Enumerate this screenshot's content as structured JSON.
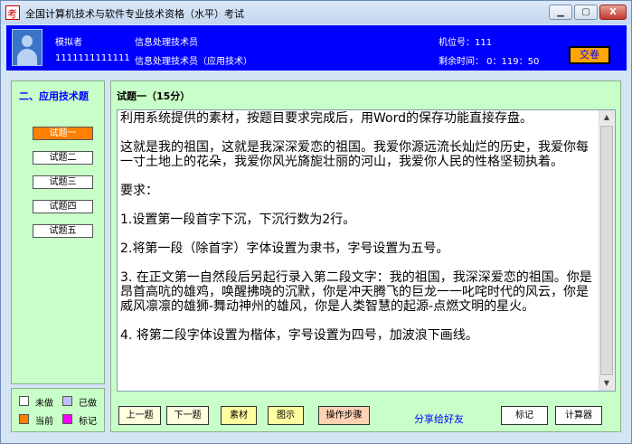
{
  "window": {
    "title": "全国计算机技术与软件专业技术资格（水平）考试",
    "minimize_symbol": "▁",
    "maximize_symbol": "▢",
    "close_symbol": "X"
  },
  "header": {
    "name": "模拟者",
    "candidate_no": "1111111111111",
    "exam_name": "信息处理技术员",
    "exam_subject": "信息处理技术员（应用技术）",
    "seat_label": "机位号：111",
    "time_label": "剩余时间：  0：119：50",
    "submit_label": "交卷"
  },
  "left": {
    "section_title": "二、应用技术题",
    "questions": [
      "试题一",
      "试题二",
      "试题三",
      "试题四",
      "试题五"
    ]
  },
  "legend": {
    "items": [
      {
        "label": "未做",
        "color": "#ffffff"
      },
      {
        "label": "已做",
        "color": "#c0c0ff"
      },
      {
        "label": "当前",
        "color": "#ff8000"
      },
      {
        "label": "标记",
        "color": "#ff00ff"
      }
    ]
  },
  "main": {
    "question_title": "试题一（15分）",
    "paragraphs": [
      "利用系统提供的素材，按题目要求完成后，用Word的保存功能直接存盘。",
      "这就是我的祖国，这就是我深深爱恋的祖国。我爱你源远流长灿烂的历史，我爱你每一寸土地上的花朵，我爱你风光旖旎壮丽的河山，我爱你人民的性格坚韧执着。",
      "要求：",
      "1.设置第一段首字下沉，下沉行数为2行。",
      "2.将第一段（除首字）字体设置为隶书，字号设置为五号。",
      "3. 在正文第一自然段后另起行录入第二段文字：我的祖国，我深深爱恋的祖国。你是昂首高吭的雄鸡，唤醒拂晓的沉默，你是冲天腾飞的巨龙一一叱咤时代的风云，你是威风凛凛的雄狮-舞动神州的雄风，你是人类智慧的起源-点燃文明的星火。",
      "4. 将第二段字体设置为楷体，字号设置为四号，加波浪下画线。"
    ]
  },
  "bottom": {
    "prev_label": "上一题",
    "next_label": "下一题",
    "material_label": "素材",
    "figure_label": "图示",
    "steps_label": "操作步骤",
    "share_label": "分享给好友",
    "mark_label": "标记",
    "calc_label": "计算器"
  }
}
